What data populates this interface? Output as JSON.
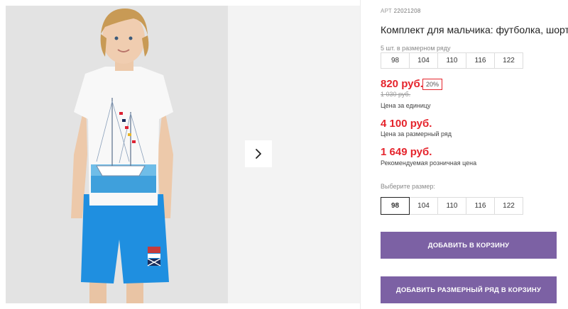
{
  "product": {
    "art_label": "АРТ",
    "art_number": "22021208",
    "title": "Комплект для мальчика: футболка, шорты"
  },
  "size_row_note": "5 шт. в размерном ряду",
  "size_row": [
    "98",
    "104",
    "110",
    "116",
    "122"
  ],
  "prices": {
    "unit_price": "820 руб.",
    "discount": "20%",
    "old_price": "1 030 руб.",
    "unit_label": "Цена за единицу",
    "row_price": "4 100 руб.",
    "row_label": "Цена за размерный ряд",
    "retail_price": "1 649 руб.",
    "retail_label": "Рекомендуемая розничная цена"
  },
  "size_picker": {
    "label": "Выберите размер:",
    "options": [
      "98",
      "104",
      "110",
      "116",
      "122"
    ],
    "selected": "98"
  },
  "buttons": {
    "add_to_cart": "ДОБАВИТЬ В КОРЗИНУ",
    "add_row_to_cart": "ДОБАВИТЬ РАЗМЕРНЫЙ РЯД В КОРЗИНУ"
  },
  "colors": {
    "accent": "#7c61a4",
    "price": "#e5242c",
    "shorts": "#1f8fe0"
  },
  "icons": {
    "next": "chevron-right-icon"
  }
}
